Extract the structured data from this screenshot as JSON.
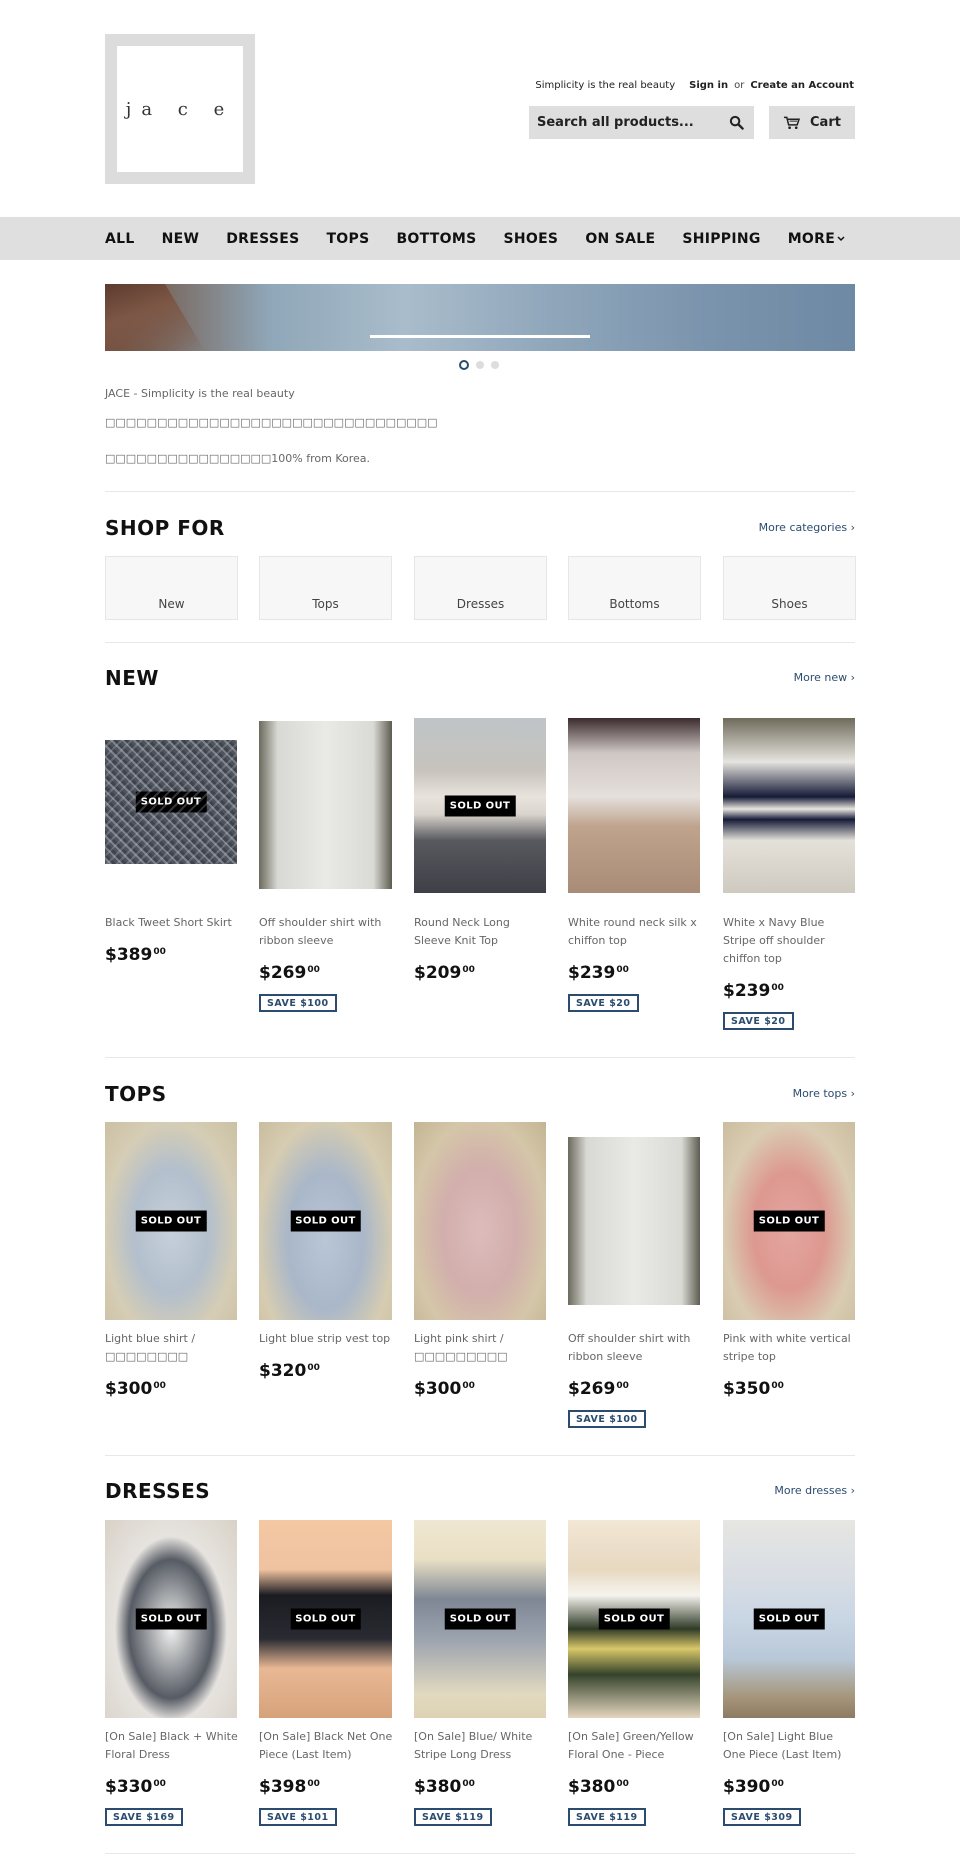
{
  "header": {
    "logo_text": "ja c e",
    "tagline": "Simplicity is the real beauty",
    "sign_in": "Sign in",
    "or": "or",
    "create_account": "Create an Account",
    "search_placeholder": "Search all products...",
    "cart_label": "Cart"
  },
  "nav": {
    "items": [
      "ALL",
      "NEW",
      "DRESSES",
      "TOPS",
      "BOTTOMS",
      "SHOES",
      "ON SALE",
      "SHIPPING"
    ],
    "more": "MORE"
  },
  "slideshow": {
    "slide_count": 3,
    "active_slide": 1
  },
  "intro": {
    "line1": "JACE - Simplicity is the real beauty",
    "line2": "□□□□□□□□□□□□□□□□□□□□□□□□□□□□□□□□",
    "line3": "□□□□□□□□□□□□□□□□100% from Korea."
  },
  "shop_for": {
    "title": "SHOP FOR",
    "more": "More categories ›",
    "categories": [
      "New",
      "Tops",
      "Dresses",
      "Bottoms",
      "Shoes"
    ]
  },
  "new_section": {
    "title": "NEW",
    "more": "More new ›",
    "products": [
      {
        "title": "Black Tweet Short Skirt",
        "price": "$389",
        "cents": "00",
        "sold_out": "SOLD OUT",
        "save": ""
      },
      {
        "title": "Off shoulder shirt with ribbon sleeve",
        "price": "$269",
        "cents": "00",
        "sold_out": "",
        "save": "SAVE $100"
      },
      {
        "title": "Round Neck Long Sleeve Knit Top",
        "price": "$209",
        "cents": "00",
        "sold_out": "SOLD OUT",
        "save": ""
      },
      {
        "title": "White round neck silk x chiffon top",
        "price": "$239",
        "cents": "00",
        "sold_out": "",
        "save": "SAVE $20"
      },
      {
        "title": "White x Navy Blue Stripe off shoulder chiffon top",
        "price": "$239",
        "cents": "00",
        "sold_out": "",
        "save": "SAVE $20"
      }
    ]
  },
  "tops_section": {
    "title": "TOPS",
    "more": "More tops ›",
    "products": [
      {
        "title": "Light blue shirt / □□□□□□□□",
        "price": "$300",
        "cents": "00",
        "sold_out": "SOLD OUT",
        "save": ""
      },
      {
        "title": "Light blue strip vest top",
        "price": "$320",
        "cents": "00",
        "sold_out": "SOLD OUT",
        "save": ""
      },
      {
        "title": "Light pink shirt / □□□□□□□□□",
        "price": "$300",
        "cents": "00",
        "sold_out": "",
        "save": ""
      },
      {
        "title": "Off shoulder shirt with ribbon sleeve",
        "price": "$269",
        "cents": "00",
        "sold_out": "",
        "save": "SAVE $100"
      },
      {
        "title": "Pink with white vertical stripe top",
        "price": "$350",
        "cents": "00",
        "sold_out": "SOLD OUT",
        "save": ""
      }
    ]
  },
  "dresses_section": {
    "title": "DRESSES",
    "more": "More dresses ›",
    "products": [
      {
        "title": "[On Sale] Black + White Floral Dress",
        "price": "$330",
        "cents": "00",
        "sold_out": "SOLD OUT",
        "save": "SAVE $169"
      },
      {
        "title": "[On Sale] Black Net One Piece (Last Item)",
        "price": "$398",
        "cents": "00",
        "sold_out": "SOLD OUT",
        "save": "SAVE $101"
      },
      {
        "title": "[On Sale] Blue/ White Stripe Long Dress",
        "price": "$380",
        "cents": "00",
        "sold_out": "SOLD OUT",
        "save": "SAVE $119"
      },
      {
        "title": "[On Sale] Green/Yellow Floral One - Piece",
        "price": "$380",
        "cents": "00",
        "sold_out": "SOLD OUT",
        "save": "SAVE $119"
      },
      {
        "title": "[On Sale] Light Blue One Piece (Last Item)",
        "price": "$390",
        "cents": "00",
        "sold_out": "SOLD OUT",
        "save": "SAVE $309"
      }
    ]
  },
  "colors": {
    "accent": "#2b4c6f",
    "nav_bg": "#dfdfdf",
    "sold_out_bg": "#000000"
  }
}
